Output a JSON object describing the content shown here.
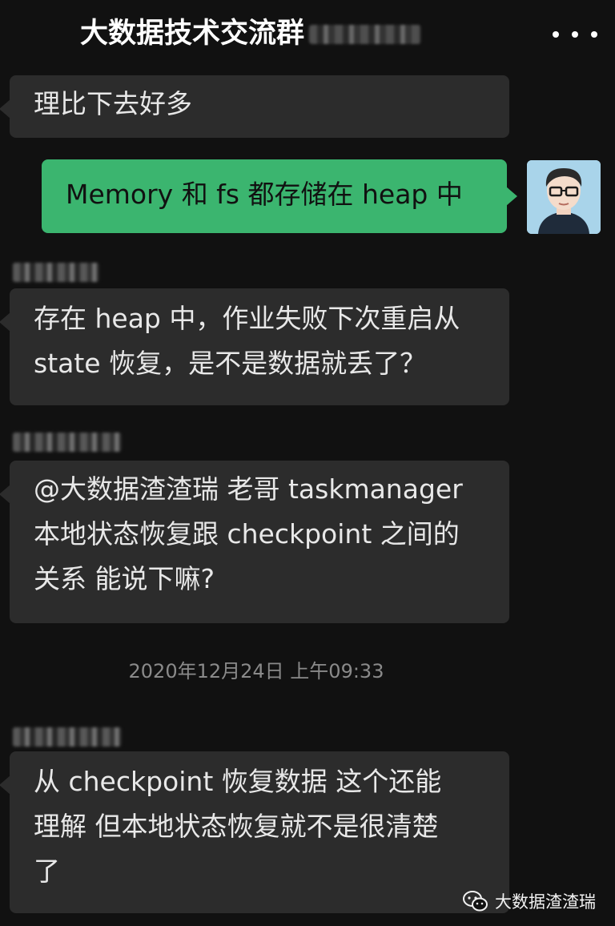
{
  "header": {
    "title": "大数据技术交流群"
  },
  "messages": [
    {
      "text": "理比下去好多"
    },
    {
      "text": "Memory 和 fs 都存储在 heap 中"
    },
    {
      "text_lines": [
        "存在 heap 中，作业失败下次重启从",
        "state 恢复，是不是数据就丢了？"
      ]
    },
    {
      "text_lines": [
        "@大数据渣渣瑞 老哥 taskmanager",
        "本地状态恢复跟 checkpoint 之间的",
        "关系 能说下嘛?"
      ]
    },
    {
      "text_lines": [
        "从 checkpoint 恢复数据 这个还能",
        "理解 但本地状态恢复就不是很清楚",
        "了"
      ]
    }
  ],
  "timestamp": "2020年12月24日 上午09:33",
  "watermark": "大数据渣渣瑞",
  "icons": {
    "more": "more-icon",
    "wechat": "wechat-icon"
  },
  "colors": {
    "background": "#111111",
    "bubble_received": "#2c2c2c",
    "bubble_sent": "#3bb56f"
  }
}
